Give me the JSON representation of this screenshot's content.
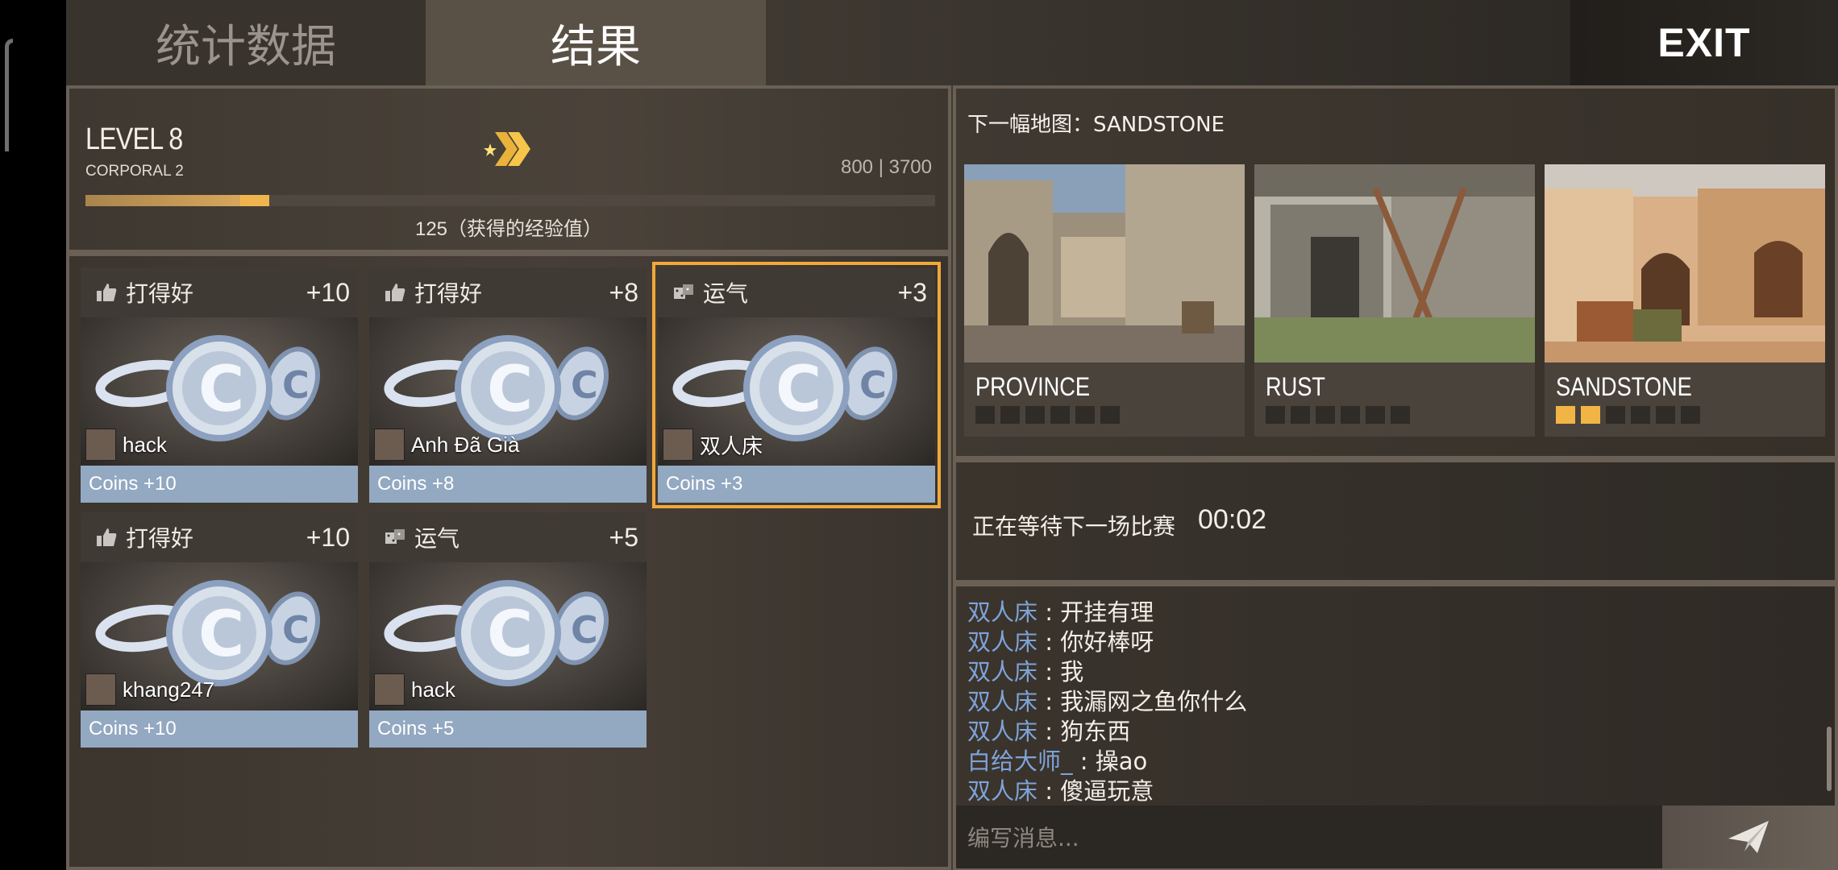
{
  "tabs": {
    "stats": "统计数据",
    "results": "结果",
    "exit": "EXIT"
  },
  "level": {
    "title": "LEVEL 8",
    "rank": "CORPORAL 2",
    "xp": "800 | 3700",
    "xp_progress": 0.216,
    "xp_gain_fraction": 0.034,
    "gain_label": "125（获得的经验值）"
  },
  "rewards": [
    {
      "category": "打得好",
      "points": "+10",
      "player": "hack",
      "coins": "Coins +10"
    },
    {
      "category": "打得好",
      "points": "+8",
      "player": "Anh Đã Già",
      "coins": "Coins +8"
    },
    {
      "category": "运气",
      "points": "+3",
      "player": "双人床",
      "coins": "Coins +3"
    },
    {
      "category": "打得好",
      "points": "+10",
      "player": "khang247",
      "coins": "Coins +10"
    },
    {
      "category": "运气",
      "points": "+5",
      "player": "hack",
      "coins": "Coins +5"
    }
  ],
  "maps": {
    "next_label": "下一幅地图：SANDSTONE",
    "items": [
      {
        "name": "PROVINCE",
        "votes": 0
      },
      {
        "name": "RUST",
        "votes": 0
      },
      {
        "name": "SANDSTONE",
        "votes": 2
      }
    ]
  },
  "waiting": {
    "text": "正在等待下一场比赛",
    "timer": "00:02"
  },
  "chat": {
    "messages": [
      {
        "who": "双人床",
        "msg": "开挂有理"
      },
      {
        "who": "双人床",
        "msg": "你好棒呀"
      },
      {
        "who": "双人床",
        "msg": "我"
      },
      {
        "who": "双人床",
        "msg": "我漏网之鱼你什么"
      },
      {
        "who": "双人床",
        "msg": "狗东西"
      },
      {
        "who": "白给大师_",
        "msg": "操ao"
      },
      {
        "who": "双人床",
        "msg": "傻逼玩意"
      }
    ],
    "placeholder": "编写消息..."
  },
  "colors": {
    "accent": "#f0a93a",
    "coins_bar": "#93a8c1",
    "chat_name": "#7fa3d8"
  }
}
